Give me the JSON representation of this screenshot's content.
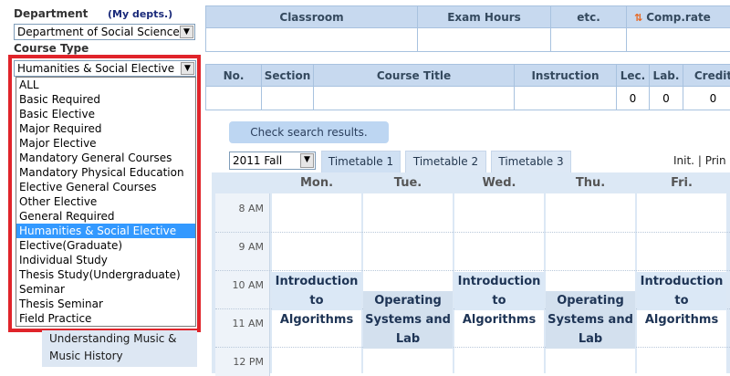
{
  "filters": {
    "department_label": "Department",
    "my_depts_label": "(My depts.)",
    "department_value": "Department of Social Science",
    "course_type_label": "Course Type",
    "course_type_value": "Humanities & Social Elective",
    "course_type_options": [
      "ALL",
      "Basic Required",
      "Basic Elective",
      "Major Required",
      "Major Elective",
      "Mandatory General Courses",
      "Mandatory Physical Education",
      "Elective General Courses",
      "Other Elective",
      "General Required",
      "Humanities & Social Elective",
      "Elective(Graduate)",
      "Individual Study",
      "Thesis Study(Undergraduate)",
      "Seminar",
      "Thesis Seminar",
      "Field Practice"
    ],
    "selected_option_index": 10
  },
  "subject_card": {
    "line1": "Understanding Music &",
    "line2": "Music History"
  },
  "summary_table": {
    "headers": [
      "Classroom",
      "Exam Hours",
      "etc.",
      "Comp.rate"
    ],
    "comp_icon": "swap-arrows-icon"
  },
  "course_table": {
    "headers": [
      "No.",
      "Section",
      "Course Title",
      "Instruction",
      "Lec.",
      "Lab.",
      "Credit"
    ],
    "row": [
      "",
      "",
      "",
      "",
      "0",
      "0",
      "0"
    ]
  },
  "check_button_label": "Check search results.",
  "timetable": {
    "term_value": "2011 Fall",
    "tabs": [
      "Timetable 1",
      "Timetable 2",
      "Timetable 3"
    ],
    "active_tab": 0,
    "init_label": "Init.",
    "separator": "|",
    "print_label": "Prin",
    "days": [
      "Mon.",
      "Tue.",
      "Wed.",
      "Thu.",
      "Fri."
    ],
    "times": [
      "8 AM",
      "9 AM",
      "10 AM",
      "11 AM",
      "12 PM"
    ],
    "courses": [
      {
        "day": "Mon.",
        "lines": [
          "Introduction",
          "to Algorithms"
        ]
      },
      {
        "day": "Tue.",
        "lines": [
          "Operating",
          "Systems and",
          "Lab"
        ]
      },
      {
        "day": "Wed.",
        "lines": [
          "Introduction",
          "to Algorithms"
        ]
      },
      {
        "day": "Thu.",
        "lines": [
          "Operating",
          "Systems and",
          "Lab"
        ]
      },
      {
        "day": "Fri.",
        "lines": [
          "Introduction",
          "to Algorithms"
        ]
      }
    ]
  },
  "colors": {
    "highlight_frame": "#e0242a",
    "selected_item": "#3399ff",
    "header_bg": "#c7d9ef",
    "course_block_bg": "#dbe8f6"
  }
}
